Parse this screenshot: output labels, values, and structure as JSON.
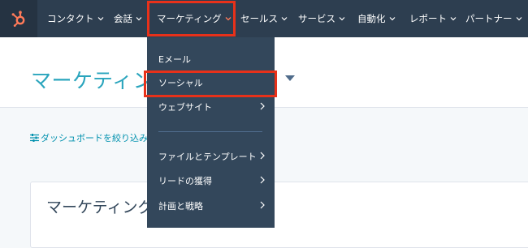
{
  "nav": {
    "items": [
      {
        "label": "コンタクト"
      },
      {
        "label": "会話"
      },
      {
        "label": "マーケティング"
      },
      {
        "label": "セールス"
      },
      {
        "label": "サービス"
      },
      {
        "label": "自動化"
      },
      {
        "label": "レポート"
      },
      {
        "label": "パートナー"
      }
    ],
    "logo_icon": "hubspot-sprocket-icon",
    "logo_color": "#ff7a59"
  },
  "page": {
    "title": "マーケティング",
    "filter_label": "ダッシュボードを絞り込み",
    "card_title": "マーケティング"
  },
  "dropdown": {
    "items": [
      {
        "label": "Eメール",
        "has_submenu": false
      },
      {
        "label": "ソーシャル",
        "has_submenu": false
      },
      {
        "label": "ウェブサイト",
        "has_submenu": true
      },
      {
        "label": "ファイルとテンプレート",
        "has_submenu": true
      },
      {
        "label": "リードの獲得",
        "has_submenu": true
      },
      {
        "label": "計画と戦略",
        "has_submenu": true
      }
    ]
  },
  "highlight_color": "#e8311a",
  "accent_color": "#2aa5bd"
}
